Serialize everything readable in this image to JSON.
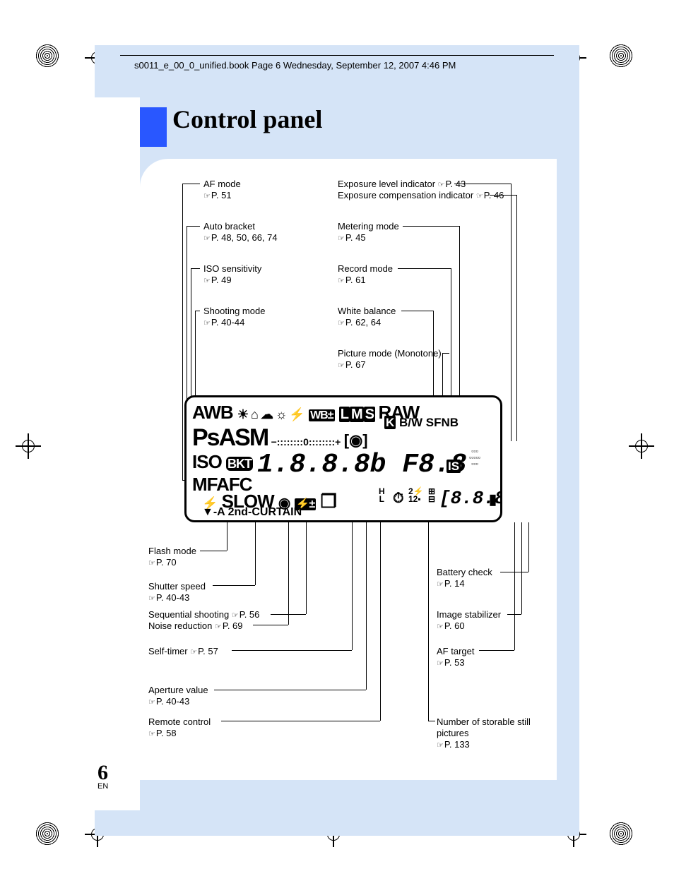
{
  "header": {
    "filepath_line": "s0011_e_00_0_unified.book  Page 6  Wednesday, September 12, 2007  4:46 PM"
  },
  "title": "Control panel",
  "page": {
    "number": "6",
    "lang": "EN"
  },
  "ref_icon": "☞",
  "leftColumn": {
    "af_mode": {
      "name": "AF mode",
      "ref": "P. 51"
    },
    "auto_bracket": {
      "name": "Auto bracket",
      "ref": "P. 48, 50, 66, 74"
    },
    "iso": {
      "name": "ISO sensitivity",
      "ref": "P. 49"
    },
    "shooting_mode": {
      "name": "Shooting mode",
      "ref": "P. 40-44"
    }
  },
  "rightColumn": {
    "exp_level": {
      "name": "Exposure level indicator",
      "ref": "P. 43"
    },
    "exp_comp": {
      "name": "Exposure compensation indicator",
      "ref": "P. 46"
    },
    "metering": {
      "name": "Metering mode",
      "ref": "P. 45"
    },
    "record": {
      "name": "Record mode",
      "ref": "P. 61"
    },
    "wb": {
      "name": "White balance",
      "ref": "P. 62, 64"
    },
    "picture_mode": {
      "name": "Picture mode (Monotone)",
      "ref": "P. 67"
    }
  },
  "bottomLeft": {
    "flash": {
      "name": "Flash mode",
      "ref": "P. 70"
    },
    "shutter": {
      "name": "Shutter speed",
      "ref": "P. 40-43"
    },
    "seq": {
      "name": "Sequential shooting",
      "ref": "P. 56"
    },
    "noise": {
      "name": "Noise reduction",
      "ref": "P. 69"
    },
    "self_timer": {
      "name": "Self-timer",
      "ref": "P. 57"
    },
    "aperture": {
      "name": "Aperture value",
      "ref": "P. 40-43"
    },
    "remote": {
      "name": "Remote control",
      "ref": "P. 58"
    }
  },
  "bottomRight": {
    "battery": {
      "name": "Battery check",
      "ref": "P. 14"
    },
    "is": {
      "name": "Image stabilizer",
      "ref": "P. 60"
    },
    "af_target": {
      "name": "AF target",
      "ref": "P. 53"
    },
    "storable": {
      "name": "Number of storable still pictures",
      "ref": "P. 133"
    }
  },
  "lcd": {
    "row1": {
      "awb": "AWB",
      "wb_icons": "☀ ⌂ ☁ ☼ ⚡",
      "wb_badge": "WB±",
      "lms": "L M S",
      "raw": "RAW"
    },
    "row2": {
      "psasm": "PsASM",
      "exp_bar": "−::::::::0::::::::+",
      "k": "K",
      "bw": "B/W",
      "sfnb": "SFNB",
      "metering": "[◉]"
    },
    "row3": {
      "iso": "ISO",
      "bkt": "BKT",
      "seg_main": "1.8.8.8b F8.8",
      "is_badge": "IS",
      "af_dots": "▫▫▫\n▫▫▫▫▫\n▫▫▫"
    },
    "row4": {
      "mfafc": "MFAFC",
      "slow": "SLOW",
      "eye": "◉",
      "flash_comp": "⚡±",
      "seq": "❐",
      "hl": "H\nL",
      "timer": "⏱",
      "twelve": "2⚡\n12▪",
      "plus_minus": "⊞\n⊟",
      "counter": "[8.8.8]",
      "batt": "▮"
    },
    "row5": {
      "curtain": "A 2nd-CURTAIN"
    }
  }
}
